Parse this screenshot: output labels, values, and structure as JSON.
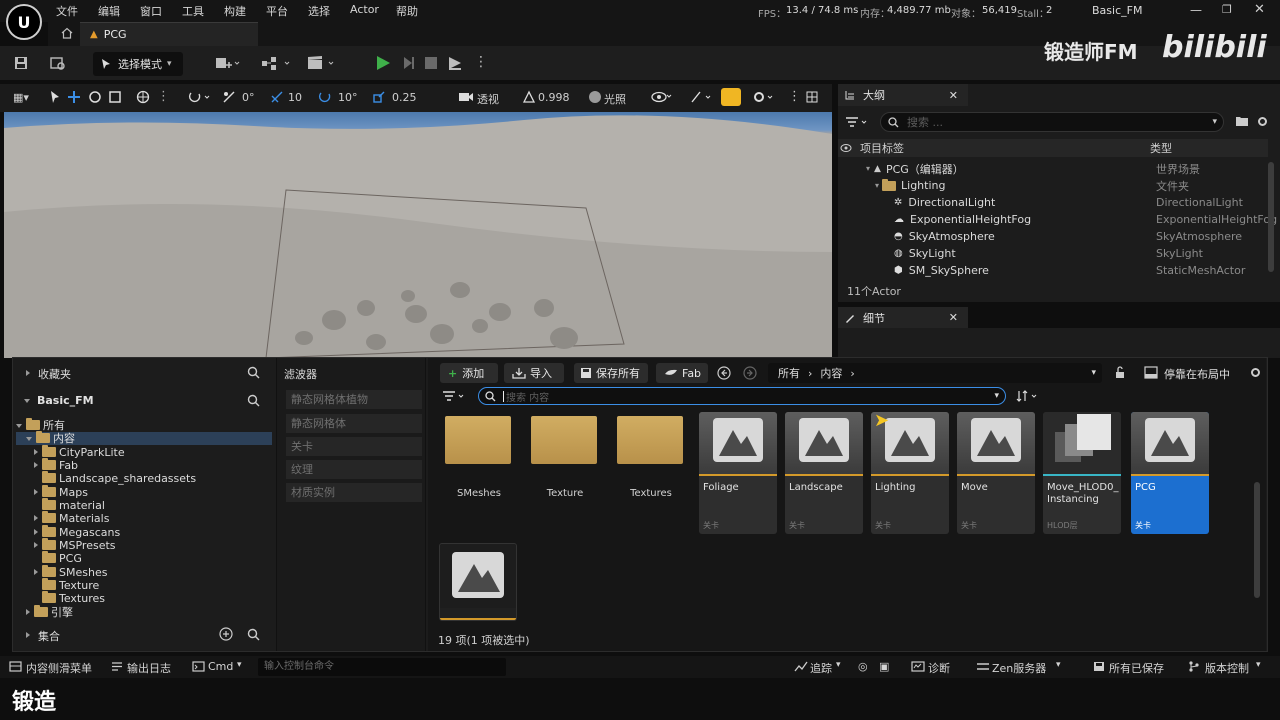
{
  "menu": [
    "文件",
    "编辑",
    "窗口",
    "工具",
    "构建",
    "平台",
    "选择",
    "Actor",
    "帮助"
  ],
  "stats": {
    "fps_label": "FPS：",
    "fps": "13.4 / 74.8 ms",
    "mem_label": "内存：",
    "mem": "4,489.77 mb",
    "obj_label": "对象：",
    "obj": "56,419",
    "stall_label": "Stall：",
    "stall": "2",
    "project": "Basic_FM"
  },
  "tab": {
    "label": "PCG"
  },
  "toolbar": {
    "mode": "选择模式"
  },
  "viewport_toolbar": {
    "grid": "0°",
    "snap": "10",
    "angle": "10°",
    "scale": "0.25",
    "view": "透视",
    "fov": "0.998",
    "lit": "光照"
  },
  "outliner": {
    "title": "大纲",
    "search_placeholder": "搜索 ...",
    "col_label": "项目标签",
    "col_type": "类型",
    "rows": [
      {
        "label": "PCG（编辑器）",
        "type": "世界场景"
      },
      {
        "label": "Lighting",
        "type": "文件夹"
      },
      {
        "label": "DirectionalLight",
        "type": "DirectionalLight"
      },
      {
        "label": "ExponentialHeightFog",
        "type": "ExponentialHeightFog"
      },
      {
        "label": "SkyAtmosphere",
        "type": "SkyAtmosphere"
      },
      {
        "label": "SkyLight",
        "type": "SkyLight"
      },
      {
        "label": "SM_SkySphere",
        "type": "StaticMeshActor"
      }
    ],
    "count": "11个Actor"
  },
  "details": {
    "title": "细节"
  },
  "content_browser": {
    "favorites": "收藏夹",
    "project": "Basic_FM",
    "tree": [
      {
        "label": "所有",
        "level": 0
      },
      {
        "label": "内容",
        "level": 1
      },
      {
        "label": "CityParkLite",
        "level": 2
      },
      {
        "label": "Fab",
        "level": 2
      },
      {
        "label": "Landscape_sharedassets",
        "level": 2
      },
      {
        "label": "Maps",
        "level": 2
      },
      {
        "label": "material",
        "level": 2
      },
      {
        "label": "Materials",
        "level": 2
      },
      {
        "label": "Megascans",
        "level": 2
      },
      {
        "label": "MSPresets",
        "level": 2
      },
      {
        "label": "PCG",
        "level": 2
      },
      {
        "label": "SMeshes",
        "level": 2
      },
      {
        "label": "Texture",
        "level": 2
      },
      {
        "label": "Textures",
        "level": 2
      },
      {
        "label": "引擎",
        "level": 1
      }
    ],
    "collections": "集合",
    "filters_title": "滤波器",
    "filters": [
      "静态网格体植物",
      "静态网格体",
      "关卡",
      "纹理",
      "材质实例"
    ],
    "add": "添加",
    "import": "导入",
    "save_all": "保存所有",
    "fab": "Fab",
    "crumb_all": "所有",
    "crumb_content": "内容",
    "dock": "停靠在布局中",
    "search_placeholder": "搜索 内容",
    "folders": [
      "SMeshes",
      "Texture",
      "Textures"
    ],
    "assets": [
      {
        "label": "Foliage",
        "type": "关卡"
      },
      {
        "label": "Landscape",
        "type": "关卡"
      },
      {
        "label": "Lighting",
        "type": "关卡"
      },
      {
        "label": "Move",
        "type": "关卡"
      },
      {
        "label": "Move_HLOD0_ Instancing",
        "type": "HLOD层"
      },
      {
        "label": "PCG",
        "type": "关卡"
      }
    ],
    "status": "19 项(1 项被选中)"
  },
  "statusbar": {
    "drawer": "内容侧滑菜单",
    "log": "输出日志",
    "cmd": "Cmd",
    "cmd_placeholder": "输入控制台命令",
    "trace": "追踪",
    "diag": "诊断",
    "zen": "Zen服务器",
    "saved": "所有已保存",
    "vcs": "版本控制"
  },
  "overlay": {
    "watermark": "锻造师FM",
    "bili": "bilibili",
    "caption": "锻造"
  },
  "colors": {
    "accent_play": "#3fb04a",
    "selection": "#1c6fd0",
    "level_bar": "#d49a2a",
    "folder": "#c3a05a"
  }
}
